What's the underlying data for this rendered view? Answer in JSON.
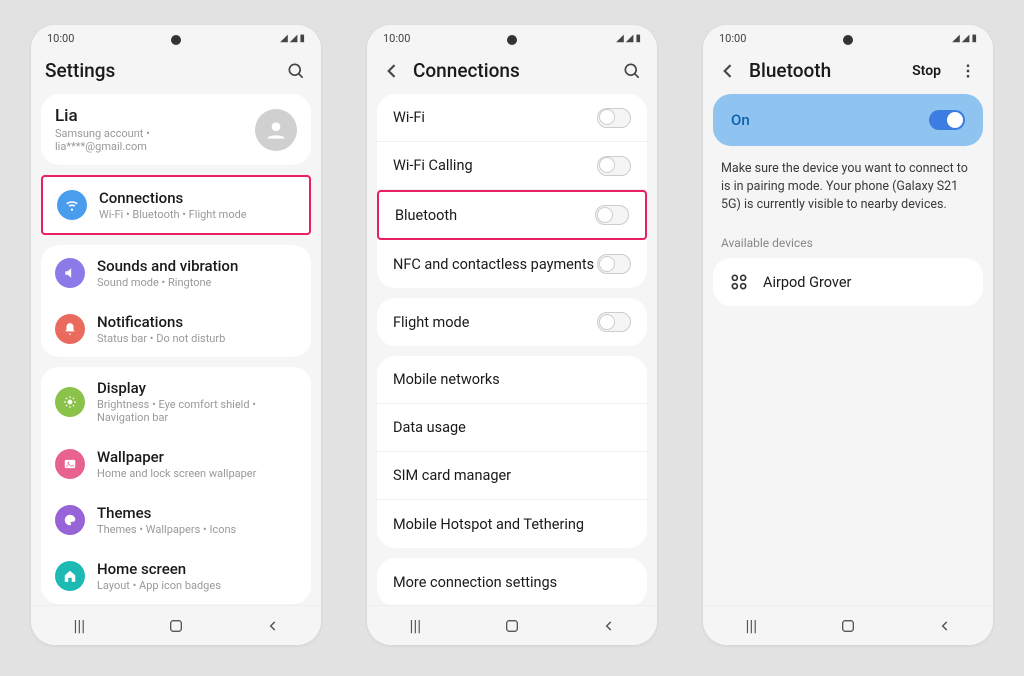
{
  "status": {
    "time": "10:00"
  },
  "screen1": {
    "title": "Settings",
    "account": {
      "name": "Lia",
      "sub": "Samsung account • lia****@gmail.com"
    },
    "connections": {
      "title": "Connections",
      "sub": "Wi-Fi • Bluetooth • Flight mode"
    },
    "sounds": {
      "title": "Sounds and vibration",
      "sub": "Sound mode • Ringtone"
    },
    "notifications": {
      "title": "Notifications",
      "sub": "Status bar • Do not disturb"
    },
    "display": {
      "title": "Display",
      "sub": "Brightness • Eye comfort shield • Navigation bar"
    },
    "wallpaper": {
      "title": "Wallpaper",
      "sub": "Home and lock screen wallpaper"
    },
    "themes": {
      "title": "Themes",
      "sub": "Themes • Wallpapers • Icons"
    },
    "homescreen": {
      "title": "Home screen",
      "sub": "Layout • App icon badges"
    }
  },
  "screen2": {
    "title": "Connections",
    "items": {
      "wifi": "Wi-Fi",
      "wificalling": "Wi-Fi Calling",
      "bluetooth": "Bluetooth",
      "nfc": "NFC and contactless payments",
      "flight": "Flight mode",
      "mobile": "Mobile networks",
      "data": "Data usage",
      "sim": "SIM card manager",
      "hotspot": "Mobile Hotspot and Tethering",
      "more": "More connection settings"
    }
  },
  "screen3": {
    "title": "Bluetooth",
    "stop": "Stop",
    "on_label": "On",
    "info": "Make sure the device you want to connect to is in pairing mode. Your phone (Galaxy S21 5G) is currently visible to nearby devices.",
    "available_label": "Available devices",
    "device1": "Airpod Grover"
  }
}
